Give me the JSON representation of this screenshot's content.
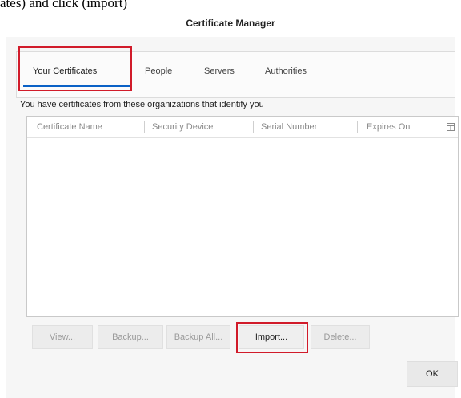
{
  "caption": "ates) and click (import)",
  "window": {
    "title": "Certificate Manager"
  },
  "tabs": [
    {
      "label": "Your Certificates",
      "selected": true
    },
    {
      "label": "People",
      "selected": false
    },
    {
      "label": "Servers",
      "selected": false
    },
    {
      "label": "Authorities",
      "selected": false
    }
  ],
  "intro_text": "You have certificates from these organizations that identify you",
  "table": {
    "columns": [
      "Certificate Name",
      "Security Device",
      "Serial Number",
      "Expires On"
    ],
    "rows": [],
    "column_picker_icon": "column-picker-icon"
  },
  "buttons": [
    {
      "label": "View...",
      "enabled": false
    },
    {
      "label": "Backup...",
      "enabled": false
    },
    {
      "label": "Backup All...",
      "enabled": false
    },
    {
      "label": "Import...",
      "enabled": true
    },
    {
      "label": "Delete...",
      "enabled": false
    }
  ],
  "ok_label": "OK",
  "colors": {
    "highlight": "#d11b2a",
    "tab_accent": "#0a61c6",
    "dialog_bg": "#f6f6f6"
  }
}
